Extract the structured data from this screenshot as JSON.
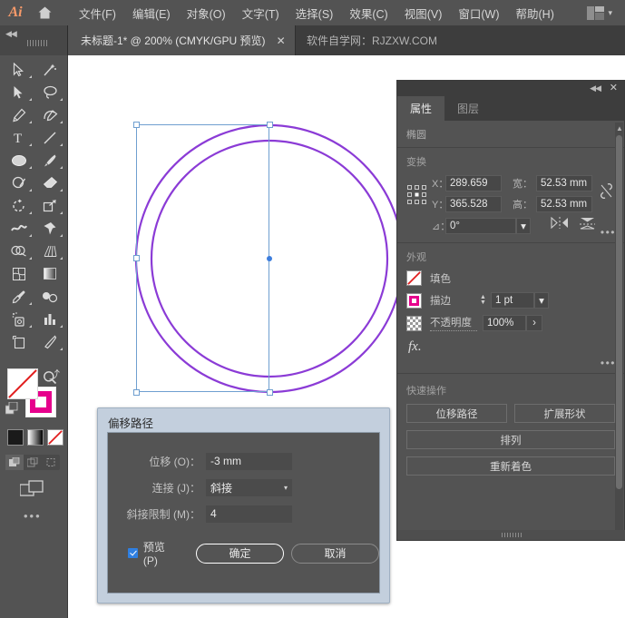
{
  "app": {
    "name": "Ai",
    "logo_text": "Ai",
    "home_icon": "home-icon"
  },
  "menubar": {
    "items": [
      {
        "label": "文件(F)",
        "name": "menu-file"
      },
      {
        "label": "编辑(E)",
        "name": "menu-edit"
      },
      {
        "label": "对象(O)",
        "name": "menu-object"
      },
      {
        "label": "文字(T)",
        "name": "menu-type"
      },
      {
        "label": "选择(S)",
        "name": "menu-select"
      },
      {
        "label": "效果(C)",
        "name": "menu-effect"
      },
      {
        "label": "视图(V)",
        "name": "menu-view"
      },
      {
        "label": "窗口(W)",
        "name": "menu-window"
      },
      {
        "label": "帮助(H)",
        "name": "menu-help"
      }
    ],
    "workspace_icon": "workspace-switcher-icon",
    "workspace_chevron": "▾"
  },
  "tabbar": {
    "collapse_icon": "◀◀",
    "document_tab": {
      "title": "未标题-1* @ 200% (CMYK/GPU 预览)",
      "close": "✕"
    },
    "watermark": "软件自学网：RJZXW.COM"
  },
  "toolbar": {
    "tools": [
      {
        "name": "selection-tool",
        "icon": "arrow-outline-icon"
      },
      {
        "name": "magic-wand-tool",
        "icon": "magic-wand-icon"
      },
      {
        "name": "direct-selection-tool",
        "icon": "arrow-solid-icon"
      },
      {
        "name": "lasso-tool",
        "icon": "lasso-icon"
      },
      {
        "name": "pen-tool",
        "icon": "pen-icon"
      },
      {
        "name": "curvature-tool",
        "icon": "curvature-icon"
      },
      {
        "name": "type-tool",
        "icon": "type-T-icon"
      },
      {
        "name": "line-segment-tool",
        "icon": "line-icon"
      },
      {
        "name": "ellipse-tool",
        "icon": "ellipse-icon"
      },
      {
        "name": "paintbrush-tool",
        "icon": "paintbrush-icon"
      },
      {
        "name": "shaper-tool",
        "icon": "shaper-icon"
      },
      {
        "name": "eraser-tool",
        "icon": "eraser-icon"
      },
      {
        "name": "rotate-tool",
        "icon": "rotate-icon"
      },
      {
        "name": "scale-tool",
        "icon": "scale-icon"
      },
      {
        "name": "width-tool",
        "icon": "width-icon"
      },
      {
        "name": "free-transform-tool",
        "icon": "pushpin-icon"
      },
      {
        "name": "shape-builder-tool",
        "icon": "shape-builder-icon"
      },
      {
        "name": "perspective-grid-tool",
        "icon": "perspective-grid-icon"
      },
      {
        "name": "mesh-tool",
        "icon": "mesh-icon"
      },
      {
        "name": "gradient-tool",
        "icon": "gradient-icon"
      },
      {
        "name": "eyedropper-tool",
        "icon": "eyedropper-icon"
      },
      {
        "name": "blend-tool",
        "icon": "blend-icon"
      },
      {
        "name": "symbol-sprayer-tool",
        "icon": "symbol-sprayer-icon"
      },
      {
        "name": "column-graph-tool",
        "icon": "bar-chart-icon"
      },
      {
        "name": "artboard-tool",
        "icon": "artboard-icon"
      },
      {
        "name": "slice-tool",
        "icon": "slice-knife-icon"
      },
      {
        "name": "hand-tool",
        "icon": "hand-icon"
      },
      {
        "name": "zoom-tool",
        "icon": "magnifier-icon"
      }
    ],
    "colors": {
      "fill": "#ffffff",
      "fill_state": "none",
      "stroke": "#e6008c",
      "swap_icon": "swap-arrow-icon",
      "default_icon": "default-colors-icon"
    },
    "modes": [
      {
        "name": "color-mode-swatch",
        "icon": "solid-color-icon"
      },
      {
        "name": "gradient-mode-swatch",
        "icon": "gradient-icon"
      },
      {
        "name": "none-mode-swatch",
        "icon": "none-icon"
      }
    ],
    "draw_modes": [
      {
        "name": "draw-normal-mode",
        "icon": "draw-normal-icon",
        "active": true
      },
      {
        "name": "draw-behind-mode",
        "icon": "draw-behind-icon",
        "active": false
      },
      {
        "name": "draw-inside-mode",
        "icon": "draw-inside-icon",
        "active": false
      }
    ],
    "screen_mode_icon": "change-screen-mode-icon",
    "more_tools": "•••"
  },
  "canvas": {
    "artwork": {
      "shape": "two-concentric-ellipses",
      "stroke_color": "#8b3bd6",
      "selection_color": "#6f9fd0",
      "center_point_color": "#3c7ddd"
    }
  },
  "properties_panel": {
    "collapse_icon": "◀◀",
    "close_icon": "✕",
    "tabs": [
      {
        "label": "属性",
        "name": "tab-properties",
        "active": true
      },
      {
        "label": "图层",
        "name": "tab-layers",
        "active": false
      }
    ],
    "object_type": "椭圆",
    "transform": {
      "section_label": "变换",
      "reference_point_icon": "reference-point-grid-icon",
      "x_label": "X：",
      "x_value": "289.659",
      "y_label": "Y：",
      "y_value": "365.528",
      "w_label": "宽：",
      "w_value": "52.53 mm",
      "h_label": "高：",
      "h_value": "52.53 mm",
      "link_icon": "unlink-proportions-icon",
      "angle_label": "⊿：",
      "angle_value": "0°",
      "flip_horizontal_icon": "flip-horizontal-icon",
      "flip_vertical_icon": "flip-vertical-icon",
      "more_options": "•••"
    },
    "appearance": {
      "section_label": "外观",
      "fill_label": "填色",
      "fill_swatch": "none-swatch-icon",
      "stroke_label": "描边",
      "stroke_swatch_color": "#e6008c",
      "stroke_weight": "1 pt",
      "stroke_caret": "▾",
      "opacity_label": "不透明度",
      "opacity_value": "100%",
      "opacity_caret": "›",
      "fx_label": "fx.",
      "more_options": "•••"
    },
    "quick_actions": {
      "section_label": "快速操作",
      "buttons": [
        {
          "label": "位移路径",
          "name": "quick-action-offset-path"
        },
        {
          "label": "扩展形状",
          "name": "quick-action-expand-shape"
        },
        {
          "label": "排列",
          "name": "quick-action-arrange"
        },
        {
          "label": "重新着色",
          "name": "quick-action-recolor"
        }
      ]
    }
  },
  "dialog": {
    "title": "偏移路径",
    "fields": [
      {
        "label": "位移 (O)：",
        "value": "-3 mm",
        "name": "offset-input"
      },
      {
        "label": "连接 (J)：",
        "value": "斜接",
        "name": "join-select",
        "caret": "▾"
      },
      {
        "label": "斜接限制 (M)：",
        "value": "4",
        "name": "miter-limit-input"
      }
    ],
    "preview": {
      "label": "预览 (P)",
      "checked": true
    },
    "ok_button": "确定",
    "cancel_button": "取消"
  }
}
